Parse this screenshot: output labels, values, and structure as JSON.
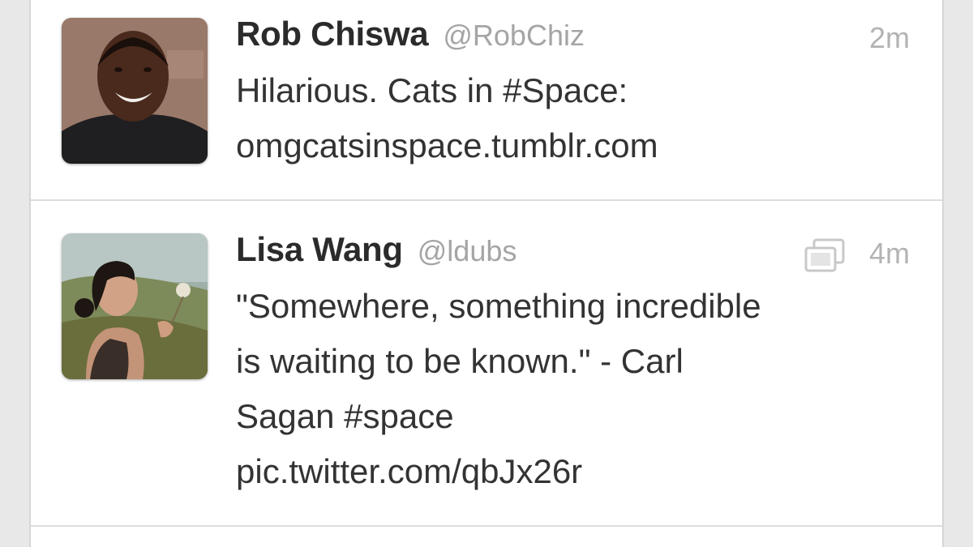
{
  "tweets": [
    {
      "name": "Rob Chiswa",
      "handle": "@RobChiz",
      "time": "2m",
      "lines": [
        "Hilarious. Cats in #Space:",
        "omgcatsinspace.tumblr.com"
      ]
    },
    {
      "name": "Lisa Wang",
      "handle": "@ldubs",
      "time": "4m",
      "media_icon": "photo-stack-icon",
      "lines": [
        "\"Somewhere, something incredible",
        "is waiting to be known.\" - Carl",
        "Sagan #space",
        "pic.twitter.com/qbJx26r"
      ]
    }
  ]
}
